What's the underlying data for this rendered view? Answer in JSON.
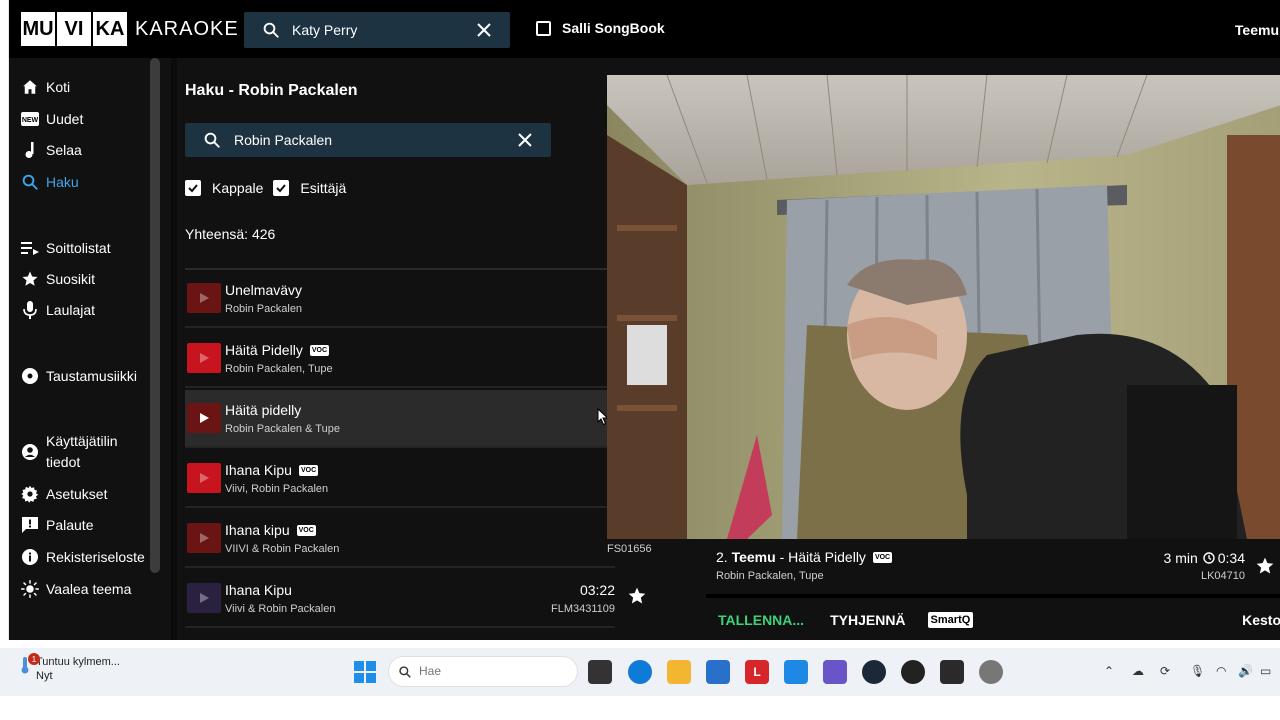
{
  "topbar": {
    "logo_boxes": [
      "MU",
      "VI",
      "KA"
    ],
    "logo_text": "KARAOKE",
    "search_value": "Katy Perry",
    "songbook_label": "Salli SongBook",
    "user": "Teemu"
  },
  "sidebar": {
    "items": [
      {
        "label": "Koti",
        "icon": "home-icon"
      },
      {
        "label": "Uudet",
        "icon": "new-icon"
      },
      {
        "label": "Selaa",
        "icon": "music-note-icon"
      },
      {
        "label": "Haku",
        "icon": "search-icon",
        "active": true
      },
      {
        "label": "Soittolistat",
        "icon": "playlist-icon"
      },
      {
        "label": "Suosikit",
        "icon": "star-icon"
      },
      {
        "label": "Laulajat",
        "icon": "microphone-icon"
      },
      {
        "label": "Taustamusiikki",
        "icon": "disc-icon"
      },
      {
        "label": "Käyttäjätilin tiedot",
        "icon": "account-icon"
      },
      {
        "label": "Asetukset",
        "icon": "gear-icon"
      },
      {
        "label": "Palaute",
        "icon": "feedback-icon"
      },
      {
        "label": "Rekisteriseloste",
        "icon": "info-icon"
      },
      {
        "label": "Vaalea teema",
        "icon": "sun-icon"
      }
    ],
    "active_color": "#3ea6e8"
  },
  "search_page": {
    "title": "Haku - Robin Packalen",
    "query": "Robin Packalen",
    "filters": [
      "Kappale",
      "Esittäjä"
    ],
    "total": "Yhteensä: 426",
    "results": [
      {
        "title": "Unelmavävy",
        "artist": "Robin Packalen",
        "voc": false,
        "duration": "",
        "code": "",
        "thumb": "#6b1414"
      },
      {
        "title": "Häitä Pidelly",
        "artist": "Robin Packalen, Tupe",
        "voc": true,
        "duration": "",
        "code": "",
        "thumb": "#c8141e"
      },
      {
        "title": "Häitä pidelly",
        "artist": "Robin Packalen & Tupe",
        "voc": false,
        "duration": "",
        "code": "",
        "thumb": "#6b1414",
        "hover": true
      },
      {
        "title": "Ihana Kipu",
        "artist": "Viivi, Robin Packalen",
        "voc": true,
        "duration": "",
        "code": "",
        "thumb": "#c8141e"
      },
      {
        "title": "Ihana kipu",
        "artist": "VIIVI & Robin Packalen",
        "voc": true,
        "duration": "",
        "code": "",
        "thumb": "#6b1414"
      },
      {
        "title": "Ihana Kipu",
        "artist": "Viivi & Robin Packalen",
        "voc": false,
        "duration": "03:22",
        "code": "FLM3431109",
        "thumb": "#2a2140"
      }
    ],
    "voc_label": "VOC"
  },
  "queue": {
    "number": "2.",
    "singer": "Teemu",
    "song": "- Häitä Pidelly",
    "artist": "Robin Packalen, Tupe",
    "wait": "3 min",
    "time": "0:34",
    "code": "LK04710",
    "prev_code": "FS01656",
    "actions": {
      "save": "TALLENNA...",
      "clear": "TYHJENNÄ",
      "smartq": "SmartQ",
      "more": "Kesto"
    },
    "save_color": "#3ed17a"
  },
  "taskbar": {
    "notification_title": "Tuntuu kylmem...",
    "notification_time": "Nyt",
    "notification_count": "1",
    "search_placeholder": "Hae",
    "apps": [
      "edge",
      "file-explorer",
      "store",
      "l-app",
      "mail",
      "teams",
      "steam",
      "xbox",
      "epic-games",
      "settings"
    ]
  }
}
